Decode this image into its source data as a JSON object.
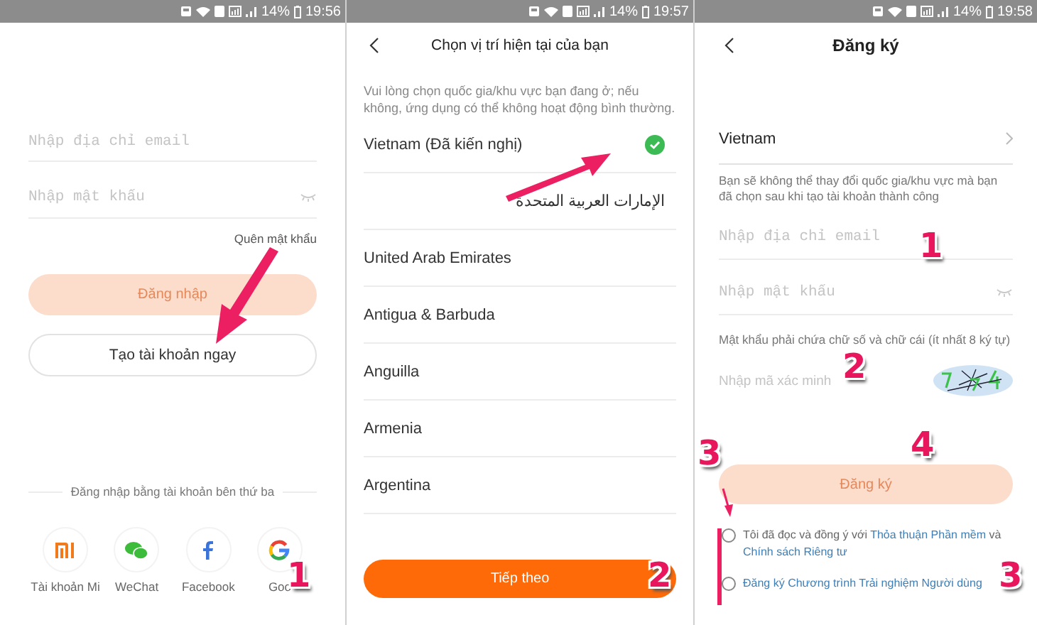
{
  "login_screen": {
    "status_bar": {
      "battery": "14%",
      "time": "19:56"
    },
    "email_field": {
      "placeholder": "Nhập địa chỉ email"
    },
    "password_field": {
      "placeholder": "Nhập mật khẩu"
    },
    "forgot_link": "Quên mật khẩu",
    "login_button": {
      "label": "Đăng nhập",
      "disabled": true
    },
    "create_button": "Tạo tài khoản ngay",
    "third_party_heading": "Đăng nhập bằng tài khoản bên thứ ba",
    "providers": [
      {
        "kind": "mi",
        "label": "Tài khoản Mi"
      },
      {
        "kind": "wechat",
        "label": "WeChat"
      },
      {
        "kind": "facebook",
        "label": "Facebook"
      },
      {
        "kind": "google",
        "label": "Goo"
      }
    ],
    "annotations": [
      {
        "label": "1"
      }
    ]
  },
  "region_screen": {
    "status_bar": {
      "battery": "14%",
      "time": "19:57"
    },
    "title": "Chọn vị trí hiện tại của bạn",
    "hint": "Vui lòng chọn quốc gia/khu vực bạn đang ở; nếu không, ứng dụng có thể không hoạt động bình thường.",
    "countries": [
      {
        "name": "Vietnam (Đã kiến nghị)",
        "selected": true
      },
      {
        "name": "الإمارات العربية المتحدة",
        "selected": false
      },
      {
        "name": "United Arab Emirates",
        "selected": false
      },
      {
        "name": "Antigua & Barbuda",
        "selected": false
      },
      {
        "name": "Anguilla",
        "selected": false
      },
      {
        "name": "Armenia",
        "selected": false
      },
      {
        "name": "Argentina",
        "selected": false
      }
    ],
    "next_button": "Tiếp theo",
    "annotations": [
      {
        "label": "2"
      }
    ]
  },
  "signup_screen": {
    "status_bar": {
      "battery": "14%",
      "time": "19:58"
    },
    "title": "Đăng ký",
    "country": "Vietnam",
    "country_note": "Bạn sẽ không thể thay đổi quốc gia/khu vực mà bạn đã chọn sau khi tạo tài khoản thành công",
    "email_field": {
      "placeholder": "Nhập địa chỉ email"
    },
    "password_field": {
      "placeholder": "Nhập mật khẩu"
    },
    "password_hint": "Mật khẩu phải chứa chữ số và chữ cái (ít nhất 8 ký tự)",
    "captcha_field": {
      "placeholder": "Nhập mã xác minh"
    },
    "signup_button": {
      "label": "Đăng ký",
      "disabled": true
    },
    "agreements": [
      {
        "checked": false,
        "parts": [
          {
            "text": "Tôi đã đọc và đồng ý với ",
            "link": false
          },
          {
            "text": "Thỏa thuận Phần mềm",
            "link": true
          },
          {
            "text": " và ",
            "link": false
          },
          {
            "text": "Chính sách Riêng tư",
            "link": true
          }
        ]
      },
      {
        "checked": false,
        "parts": [
          {
            "text": "Đăng ký Chương trình Trải nghiệm Người dùng",
            "link": true
          }
        ]
      }
    ],
    "annotations": [
      {
        "label": "1"
      },
      {
        "label": "2"
      },
      {
        "label": "3"
      },
      {
        "label": "4"
      },
      {
        "label": "3"
      }
    ]
  }
}
